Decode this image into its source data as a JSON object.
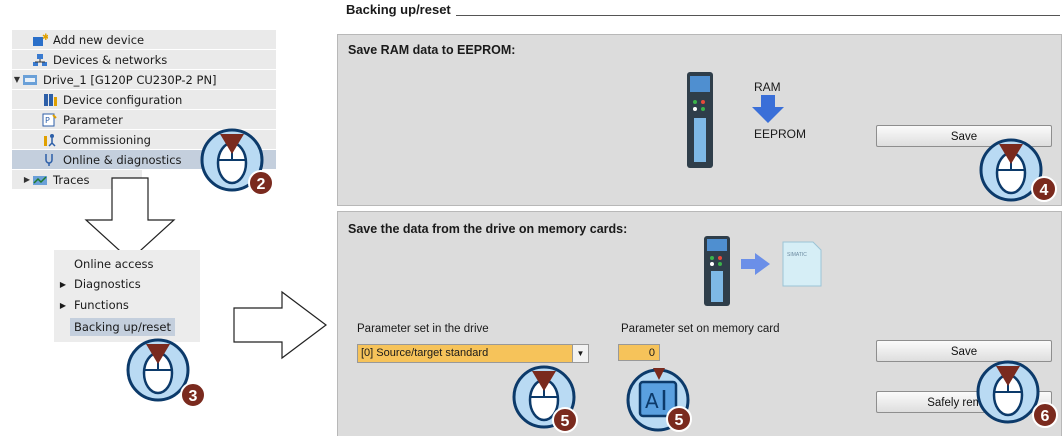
{
  "tree": {
    "items": [
      {
        "label": "Add new device",
        "icon": "add-device-icon"
      },
      {
        "label": "Devices & networks",
        "icon": "network-icon"
      },
      {
        "label": "Drive_1 [G120P CU230P-2 PN]",
        "icon": "drive-icon",
        "expanded": true
      },
      {
        "label": "Device configuration",
        "icon": "device-config-icon"
      },
      {
        "label": "Parameter",
        "icon": "parameter-icon"
      },
      {
        "label": "Commissioning",
        "icon": "commissioning-icon"
      },
      {
        "label": "Online & diagnostics",
        "icon": "online-diagnostics-icon",
        "selected": true
      },
      {
        "label": "Traces",
        "icon": "traces-icon",
        "collapsed": true
      }
    ]
  },
  "menu": {
    "items": [
      {
        "label": "Online access"
      },
      {
        "label": "Diagnostics",
        "arrow": true
      },
      {
        "label": "Functions",
        "arrow": true
      },
      {
        "label": "Backing up/reset",
        "selected": true
      }
    ]
  },
  "panel": {
    "title": "Backing up/reset",
    "ram_group": {
      "title": "Save RAM data to EEPROM:",
      "ram_label": "RAM",
      "eeprom_label": "EEPROM",
      "save_label": "Save"
    },
    "card_group": {
      "title": "Save the data from the drive on memory cards:",
      "param_drive_label": "Parameter set in the drive",
      "param_card_label": "Parameter set on memory card",
      "drive_select_value": "[0] Source/target standard",
      "card_value": "0",
      "save_label": "Save",
      "safely_remove_label": "Safely remove"
    }
  },
  "callouts": [
    "2",
    "3",
    "4",
    "5",
    "5",
    "6"
  ],
  "colors": {
    "badge": "#7a2a1e",
    "selection": "#c4cfdd",
    "input_highlight": "#f6c35a",
    "arrow_blue": "#3a6fd8"
  }
}
